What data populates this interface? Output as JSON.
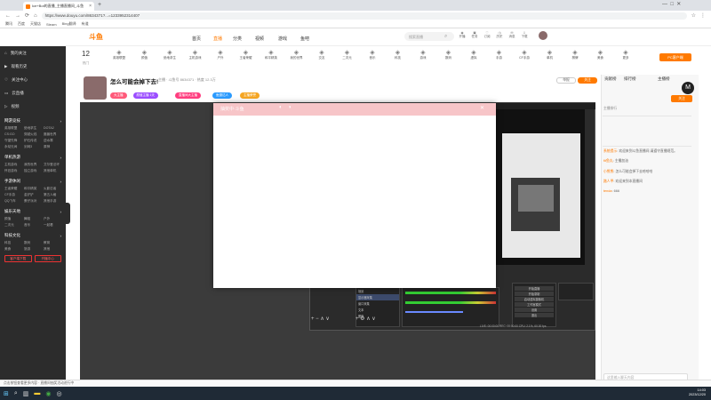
{
  "browser": {
    "tab_title": "Ice+Bot的直播_主播直播间_斗鱼",
    "url": "https://www.douyu.com/8634371?...=1233952314407",
    "bookmarks": [
      "腾讯",
      "百度",
      "天猫店",
      "Steam",
      "Bing翻译",
      "有道"
    ]
  },
  "site": {
    "logo": "斗鱼",
    "nav": [
      "首页",
      "直播",
      "分类",
      "视频",
      "游戏",
      "鱼吧"
    ],
    "search_placeholder": "搜索直播",
    "header_icons": [
      "开播",
      "任务",
      "订阅",
      "历史",
      "消息",
      "下载"
    ],
    "pc_client": "PC客户端",
    "categories": [
      "热门",
      "英雄联盟",
      "颜值",
      "绝地求生",
      "主机游戏",
      "户外",
      "王者荣耀",
      "和平精英",
      "我的世界",
      "交友",
      "二次元",
      "音乐",
      "科技",
      "游戏",
      "数码",
      "虚拟",
      "手游",
      "CF手游",
      "单机",
      "棋牌",
      "美食",
      "更多"
    ]
  },
  "sidebar": {
    "top": [
      {
        "icon": "home-icon",
        "label": "我的关注"
      },
      {
        "icon": "play-icon",
        "label": "观看历史"
      },
      {
        "icon": "heart-icon",
        "label": "关注中心"
      },
      {
        "icon": "tv-icon",
        "label": "云直播"
      },
      {
        "icon": "video-icon",
        "label": "视频"
      }
    ],
    "sections": [
      {
        "title": "网游竞技",
        "items": [
          "英雄联盟",
          "绝地求生",
          "DOTA2",
          "CS:GO",
          "穿越火线",
          "魔兽世界",
          "守望先锋",
          "炉石传说",
          "逆水寒",
          "永劫无间",
          "剑网3",
          "原神"
        ]
      },
      {
        "title": "单机热游",
        "items": [
          "主机游戏",
          "我的世界",
          "艾尔登法环",
          "怀旧游戏",
          "独立游戏",
          "其他单机"
        ]
      },
      {
        "title": "手游休闲",
        "items": [
          "王者荣耀",
          "和平精英",
          "火影忍者",
          "CF手游",
          "金铲铲",
          "第五人格",
          "QQ飞车",
          "蛋仔派对",
          "其他手游"
        ]
      },
      {
        "title": "娱乐天地",
        "items": [
          "颜值",
          "舞蹈",
          "户外",
          "二次元",
          "音乐",
          "一起看"
        ]
      },
      {
        "title": "科技文化",
        "items": [
          "科技",
          "数码",
          "教育",
          "美食",
          "旅游",
          "其他"
        ]
      }
    ],
    "buttons": [
      "客户端下载",
      "开播中心"
    ]
  },
  "room": {
    "title": "怎么可能会掉下去!",
    "meta": "主播 · 斗鱼号 8634371 · 热度 12.3万",
    "badges": [
      {
        "text": "大主播",
        "color": "#ff5a7a"
      },
      {
        "text": "颜值主播 1天",
        "color": "#9b4dff"
      },
      {
        "text": "直播间大主播",
        "color": "#ff3d7f"
      },
      {
        "text": "鱼翅达人",
        "color": "#2b9bff"
      },
      {
        "text": "主播荣誉",
        "color": "#f6a623"
      }
    ],
    "follow": "关注",
    "report": "举报"
  },
  "dialog": {
    "title": "抽奖中·斗鱼"
  },
  "obs": {
    "title": "OBS 29.1.3 - 配置文件: 未命名 - 场景: 未命名",
    "scenes": [
      "场景",
      "显示器采集",
      "窗口采集",
      "文本",
      "图像"
    ],
    "sources": [
      "显示器采集",
      "窗口采集",
      "音频",
      "摄像头"
    ],
    "controls": [
      "开始直播",
      "开始录制",
      "启动虚拟摄像机",
      "工作室模式",
      "设置",
      "退出"
    ],
    "status": "LIVE: 00:00:00  REC: 00:00:00  CPU: 2.1%, 60.00 fps"
  },
  "right_panel": {
    "tabs": [
      "贡献榜",
      "排行榜",
      "主播榜"
    ],
    "rank_label": "主播排行",
    "follow_btn": "关注",
    "chat": [
      {
        "user": "系统提示",
        "text": "欢迎来到斗鱼直播间,请遵守直播规范。"
      },
      {
        "user": "fit鱼丸",
        "text": "主播加油"
      },
      {
        "user": "小熊熊",
        "text": "怎么可能会掉下去哈哈哈"
      },
      {
        "user": "路人甲",
        "text": "欢迎来到本直播间"
      },
      {
        "user": "tenda",
        "text": "666"
      }
    ],
    "input_placeholder": "这里输入聊天内容"
  },
  "statusbar": {
    "text": "点击按钮查看更多内容 · 直播间抽奖活动进行中"
  },
  "taskbar": {
    "time": "14:03",
    "date": "2023/12/20"
  },
  "colors": {
    "accent": "#ff7a00",
    "sidebar": "#2c2c2c",
    "dialog_head": "#f7c5c8"
  }
}
